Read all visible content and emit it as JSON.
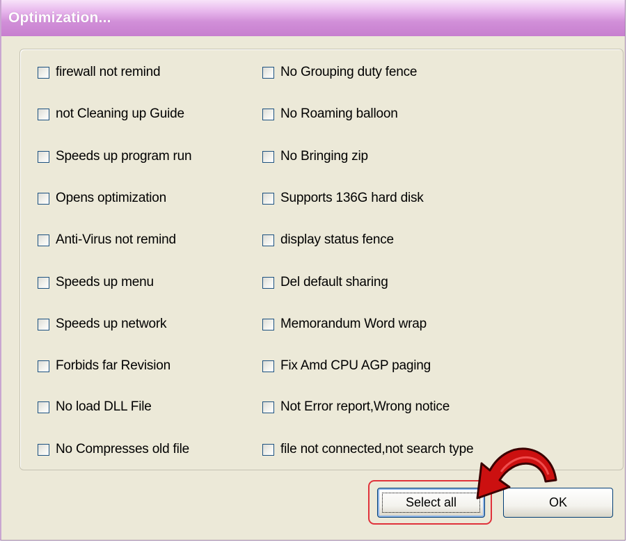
{
  "window": {
    "title": "Optimization..."
  },
  "options": {
    "left": [
      "firewall not remind",
      "not Cleaning up Guide",
      "Speeds up program run",
      "Opens optimization",
      "Anti-Virus not remind",
      "Speeds up menu",
      "Speeds up network",
      "Forbids far Revision",
      "No load DLL File",
      "No Compresses old file"
    ],
    "right": [
      "No Grouping duty fence",
      "No Roaming balloon",
      "No Bringing zip",
      "Supports 136G hard disk",
      "display status fence",
      "Del default sharing",
      "Memorandum Word wrap",
      "Fix Amd CPU AGP paging",
      "Not Error report,Wrong notice",
      "file not connected,not search type"
    ],
    "checked": false
  },
  "buttons": {
    "select_all": "Select all",
    "ok": "OK"
  },
  "annotation": {
    "highlight_color": "#e0323a",
    "arrow_color": "#cc1010",
    "arrow_icon": "curved-arrow-icon"
  }
}
